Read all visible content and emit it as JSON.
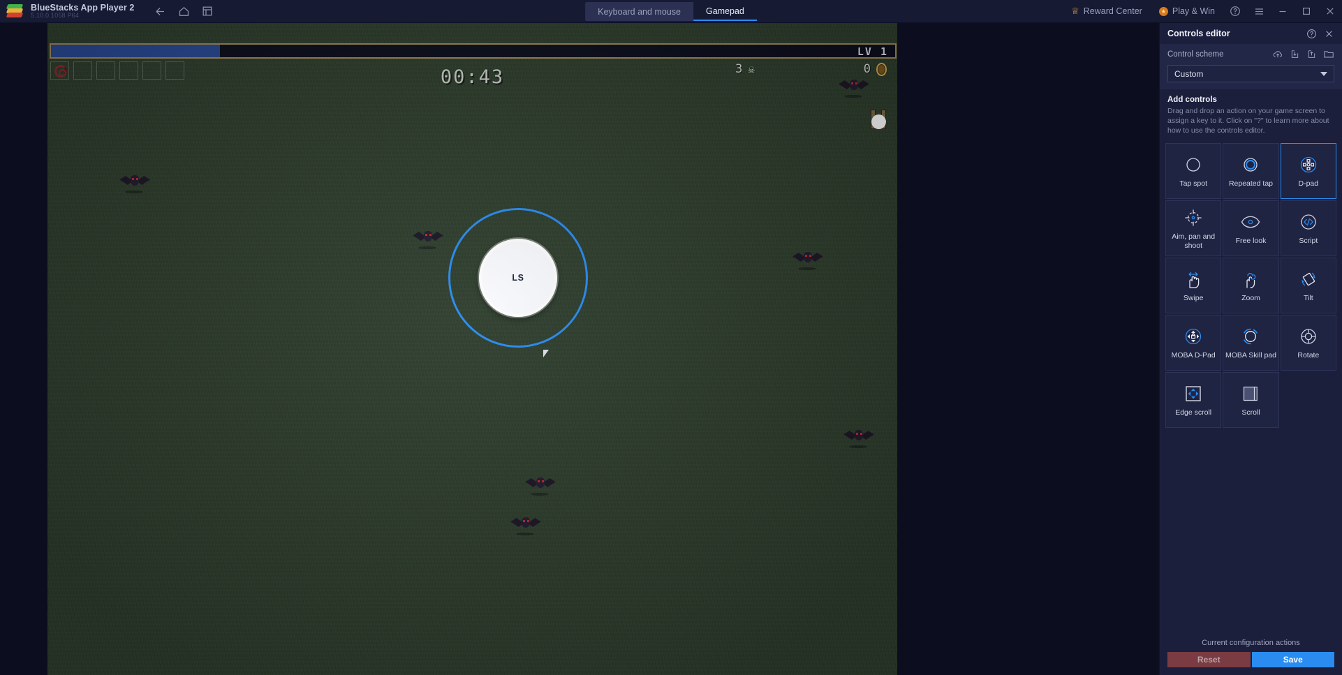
{
  "titlebar": {
    "app_name": "BlueStacks App Player 2",
    "version": "5.10.0.1058  P64",
    "nav_icons": [
      {
        "name": "back-icon",
        "label": "Back"
      },
      {
        "name": "home-icon",
        "label": "Home"
      },
      {
        "name": "multi-instance-icon",
        "label": "Multi-instance"
      }
    ],
    "tabs": [
      {
        "label": "Keyboard and mouse",
        "active": false
      },
      {
        "label": "Gamepad",
        "active": true
      }
    ],
    "reward_center": "Reward Center",
    "play_and_win": "Play & Win",
    "window_icons": [
      {
        "name": "help-icon"
      },
      {
        "name": "hamburger-menu-icon"
      },
      {
        "name": "minimize-icon"
      },
      {
        "name": "maximize-icon"
      },
      {
        "name": "close-icon"
      }
    ]
  },
  "game": {
    "level_label": "LV 1",
    "xp_percent": 20,
    "timer": "00:43",
    "kill_count": "3",
    "coin_count": "0",
    "joystick_label": "LS",
    "item_slots": 6
  },
  "panel": {
    "title": "Controls editor",
    "header_icons": [
      {
        "name": "help-icon"
      },
      {
        "name": "close-icon"
      }
    ],
    "scheme": {
      "label": "Control scheme",
      "selected": "Custom",
      "icons": [
        {
          "name": "cloud-sync-icon"
        },
        {
          "name": "import-scheme-icon"
        },
        {
          "name": "export-scheme-icon"
        },
        {
          "name": "open-folder-icon"
        }
      ]
    },
    "add_controls": {
      "title": "Add controls",
      "description": "Drag and drop an action on your game screen to assign a key to it. Click on \"?\" to learn more about how to use the controls editor.",
      "cards": [
        {
          "label": "Tap spot",
          "icon": "tap-spot-icon",
          "selected": false
        },
        {
          "label": "Repeated tap",
          "icon": "repeated-tap-icon",
          "selected": false
        },
        {
          "label": "D-pad",
          "icon": "d-pad-icon",
          "selected": true
        },
        {
          "label": "Aim, pan and shoot",
          "icon": "aim-pan-shoot-icon",
          "selected": false
        },
        {
          "label": "Free look",
          "icon": "free-look-icon",
          "selected": false
        },
        {
          "label": "Script",
          "icon": "script-icon",
          "selected": false
        },
        {
          "label": "Swipe",
          "icon": "swipe-icon",
          "selected": false
        },
        {
          "label": "Zoom",
          "icon": "zoom-icon",
          "selected": false
        },
        {
          "label": "Tilt",
          "icon": "tilt-icon",
          "selected": false
        },
        {
          "label": "MOBA D-Pad",
          "icon": "moba-d-pad-icon",
          "selected": false
        },
        {
          "label": "MOBA Skill pad",
          "icon": "moba-skill-pad-icon",
          "selected": false
        },
        {
          "label": "Rotate",
          "icon": "rotate-icon",
          "selected": false
        },
        {
          "label": "Edge scroll",
          "icon": "edge-scroll-icon",
          "selected": false
        },
        {
          "label": "Scroll",
          "icon": "scroll-icon",
          "selected": false
        }
      ]
    },
    "footer": {
      "title": "Current configuration actions",
      "reset_label": "Reset",
      "save_label": "Save"
    }
  },
  "colors": {
    "accent_blue": "#2a8cf0",
    "panel_bg": "#1b1f3c",
    "card_bg": "#1f2442",
    "reset_red": "#7a3b42",
    "xp_blue": "#2a4a93",
    "game_green": "#2d3d2c"
  }
}
